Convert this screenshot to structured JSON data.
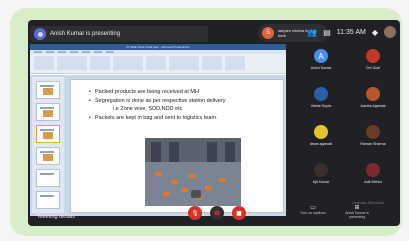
{
  "meet": {
    "presenting_text": "Anish Kumar is presenting",
    "notification": {
      "badge": "S",
      "text": "satyam mishra is also here"
    },
    "clock": "11:35 AM",
    "icons": [
      "people-icon",
      "chat-icon",
      "activities-icon"
    ]
  },
  "presentation": {
    "window_title": "Dr Slide Deck Final.pptx - Microsoft PowerPoint",
    "bullets": [
      "Packed products are being received at MH",
      "Segregation is done as per respective station delivery",
      "i.e Zone wise, SDD,NDD etc",
      "Packets are kept in bag and sent to logistics team."
    ]
  },
  "participants": [
    {
      "name": "Anish Kumar",
      "letter": "A",
      "color": "#4a8df1"
    },
    {
      "name": "Om Goel",
      "color": "#c0392b"
    },
    {
      "name": "Vishal Gupta",
      "color": "#2b5fa8"
    },
    {
      "name": "Aastha Agarwal",
      "color": "#b8572f"
    },
    {
      "name": "dewa agarwal",
      "color": "#e6c12e"
    },
    {
      "name": "Raman Sharma",
      "color": "#6a3c2a"
    },
    {
      "name": "Ajit Kumar",
      "color": "#3a2f2a"
    },
    {
      "name": "Adit Mehra",
      "color": "#7a2c2c"
    }
  ],
  "bottom": {
    "meeting_details": "Meeting details",
    "turn_on_captions": "Turn on captions",
    "present_now": "Anish Kumar is presenting",
    "watermark": "Activate Windows"
  }
}
